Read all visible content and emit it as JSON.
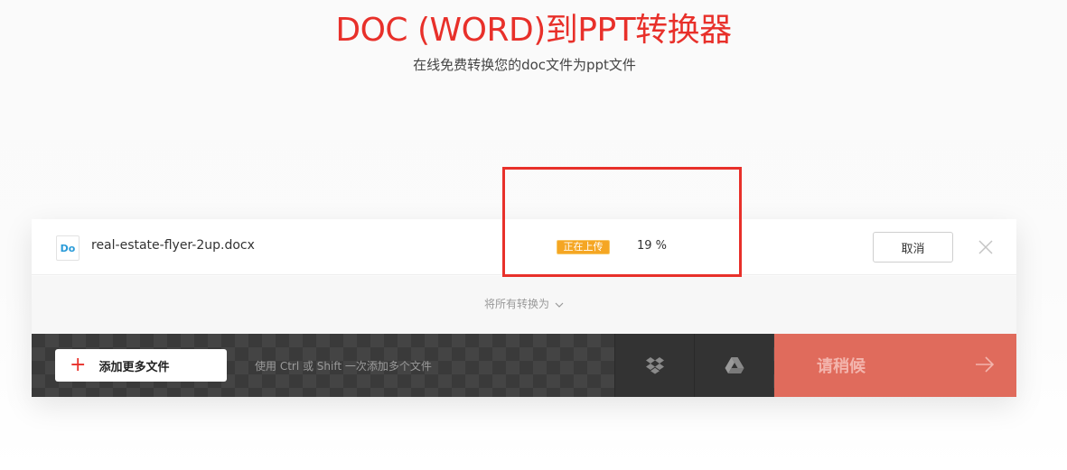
{
  "header": {
    "title": "DOC (WORD)到PPT转换器",
    "subtitle": "在线免费转换您的doc文件为ppt文件"
  },
  "file": {
    "icon_text": "Do",
    "icon": "doc-file-icon",
    "name": "real-estate-flyer-2up.docx",
    "status": "正在上传",
    "progress_label": "19 %",
    "progress": 19,
    "cancel_label": "取消",
    "close_icon": "close-icon"
  },
  "convert": {
    "label": "将所有转换为",
    "icon": "chevron-down-icon"
  },
  "toolbar": {
    "add_label": "添加更多文件",
    "add_icon": "plus-icon",
    "hint": "使用 Ctrl 或 Shift 一次添加多个文件",
    "dropbox_icon": "dropbox-icon",
    "gdrive_icon": "google-drive-icon",
    "wait_label": "请稍候",
    "wait_icon": "arrow-right-icon"
  },
  "colors": {
    "brand": "#e8302a",
    "status": "#f5a623",
    "wait_button": "#e06b5c",
    "toolbar": "#3a3a3a"
  }
}
